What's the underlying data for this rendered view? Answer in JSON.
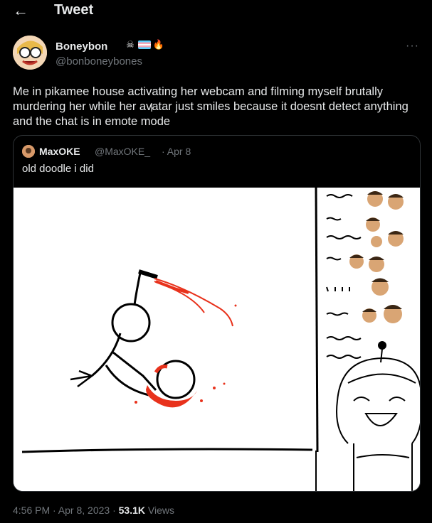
{
  "header": {
    "title": "Tweet",
    "back_icon": "arrow-left-icon"
  },
  "author": {
    "name": "Boneybon",
    "handle": "@bonboneybones",
    "badges": [
      "skull-icon",
      "trans-flag-icon",
      "fire-icon"
    ],
    "more_label": "···"
  },
  "tweet": {
    "text": "Me in pikamee house activating her webcam and filming myself brutally murdering her while her avatar just smiles because it doesnt detect anything and the chat is in emote mode"
  },
  "quote": {
    "name": "MaxOKE",
    "handle": "@MaxOKE_",
    "date": "· Apr 8",
    "text": "old doodle i did"
  },
  "footer": {
    "time": "4:56 PM · Apr 8, 2023 · ",
    "views_count": "53.1K",
    "views_label": " Views"
  },
  "colors": {
    "background": "#000000",
    "text": "#e7e9ea",
    "muted": "#71767b",
    "border": "#2f3336",
    "blood": "#e8321c"
  }
}
